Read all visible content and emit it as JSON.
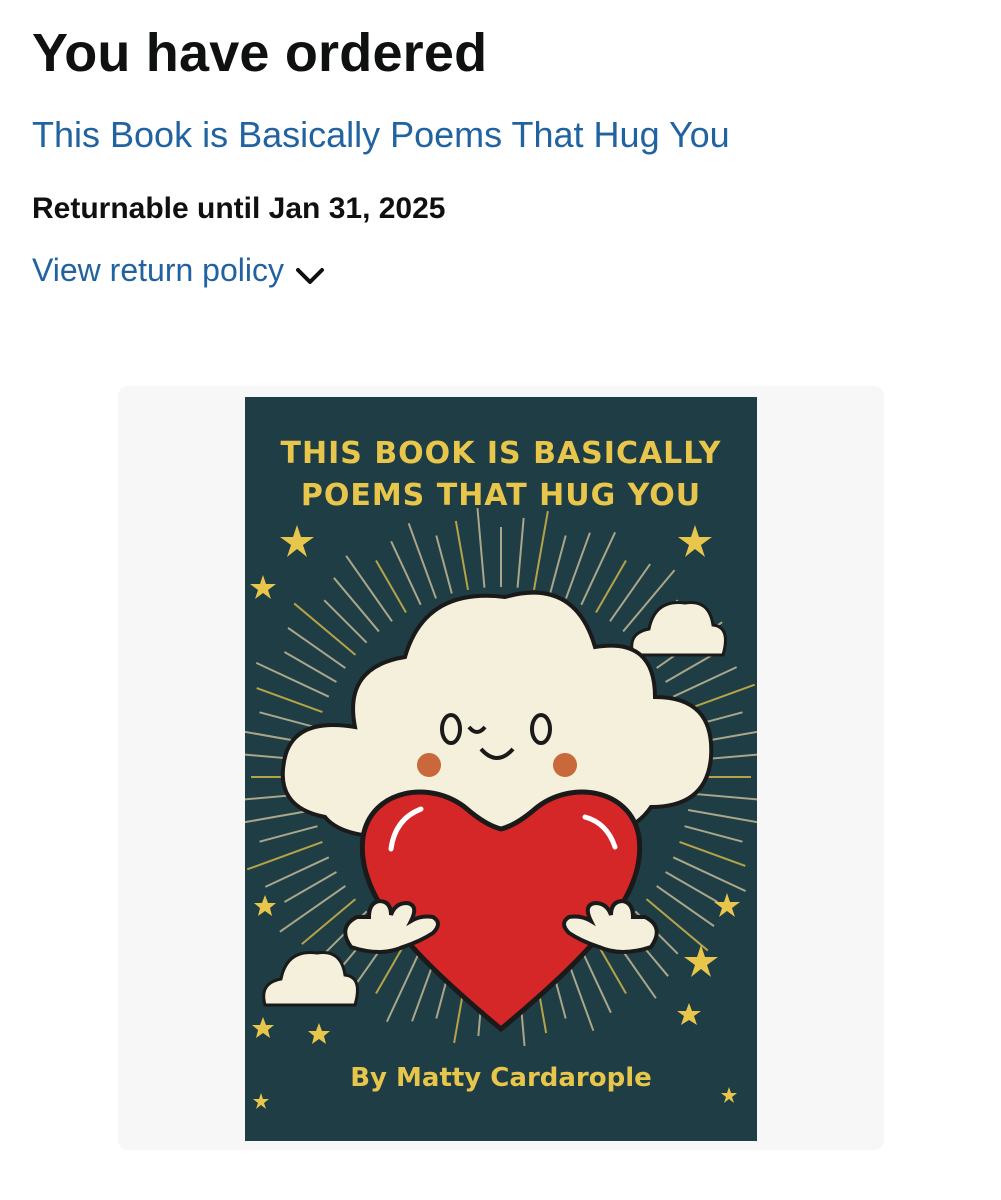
{
  "header": {
    "title": "You have ordered"
  },
  "order": {
    "product_title": "This Book is Basically Poems That Hug You",
    "returnable": "Returnable until Jan 31, 2025",
    "return_policy_link": "View return policy"
  },
  "cover": {
    "title_line1": "THIS BOOK IS BASICALLY",
    "title_line2": "POEMS THAT HUG YOU",
    "author": "By Matty Cardarople"
  },
  "colors": {
    "link": "#2162a1",
    "text": "#0f1111",
    "cover_bg": "#1f3d44",
    "cover_accent": "#e8c64b",
    "heart": "#d62728",
    "cloud": "#f5f0dc"
  },
  "icons": {
    "policy_toggle": "chevron-down-icon"
  }
}
